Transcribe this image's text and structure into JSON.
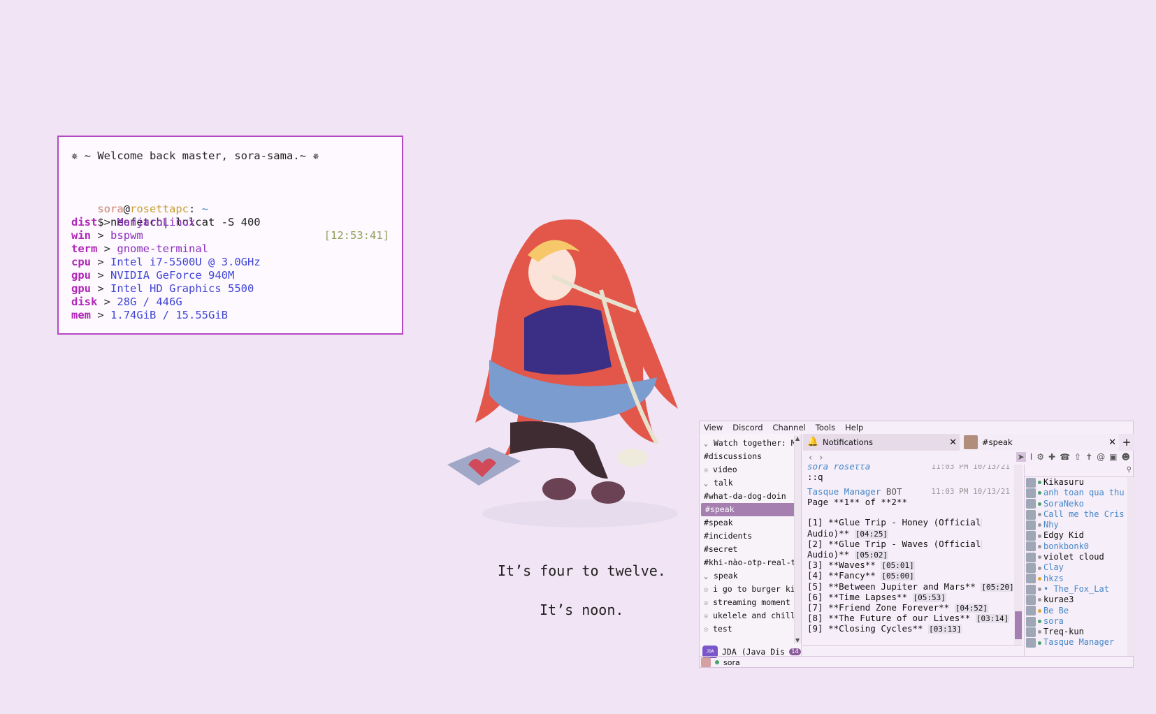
{
  "terminal": {
    "welcome": "✵ ~ Welcome back master, sora-sama.~ ✵",
    "prompt_user": "sora",
    "prompt_at": "@",
    "prompt_host": "rosettapc",
    "prompt_sep": ": ",
    "prompt_dir": "~",
    "command": "$ neofetch| lolcat -S 400",
    "time": "[12:53:41]",
    "neofetch": [
      {
        "key": "dist",
        "value": "ManjaroLinux"
      },
      {
        "key": "win",
        "value": "bspwm"
      },
      {
        "key": "term",
        "value": "gnome-terminal"
      },
      {
        "key": "cpu",
        "value": "Intel i7-5500U @ 3.0GHz"
      },
      {
        "key": "gpu",
        "value": "NVIDIA GeForce 940M"
      },
      {
        "key": "gpu",
        "value": "Intel HD Graphics 5500"
      },
      {
        "key": "disk",
        "value": "28G / 446G"
      },
      {
        "key": "mem",
        "value": "1.74GiB / 15.55GiB"
      }
    ],
    "arrow": ">"
  },
  "captions": {
    "line1": "It’s four to twelve.",
    "line2": "It’s noon."
  },
  "client": {
    "menu": [
      "View",
      "Discord",
      "Channel",
      "Tools",
      "Help"
    ],
    "channels": [
      {
        "type": "category",
        "label": "Watch together: MC"
      },
      {
        "type": "text",
        "label": "#discussions"
      },
      {
        "type": "voice",
        "label": "video"
      },
      {
        "type": "category",
        "label": "talk"
      },
      {
        "type": "text",
        "label": "#what-da-dog-doin"
      },
      {
        "type": "text",
        "label": "#speak",
        "selected": true
      },
      {
        "type": "text",
        "label": "#speak"
      },
      {
        "type": "text",
        "label": "#incidents"
      },
      {
        "type": "text",
        "label": "#secret"
      },
      {
        "type": "text",
        "label": "#khi-nào-otp-real-th"
      },
      {
        "type": "category",
        "label": "speak"
      },
      {
        "type": "voice",
        "label": "i go to burger kin"
      },
      {
        "type": "voice",
        "label": "streaming moment"
      },
      {
        "type": "voice",
        "label": "ukelele and chill"
      },
      {
        "type": "voice",
        "label": "test"
      }
    ],
    "guild": {
      "label": "JDA (Java Dis",
      "icon_text": "JDA",
      "badge": "14"
    },
    "self_user": "sora",
    "tabs": [
      {
        "label": "Notifications",
        "close": "✕"
      },
      {
        "label": "#speak",
        "close": "✕"
      }
    ],
    "new_tab": "+",
    "messages": {
      "prev_author": "sora rosetta",
      "prev_meta": "11:03 PM  10/13/21",
      "prev_text": "::q",
      "author": "Tasque Manager",
      "bot_tag": "BOT",
      "meta": "11:03 PM  10/13/21",
      "page_line": "Page **1** of **2**",
      "lines": [
        {
          "text": "[1] **Glue Trip -  Honey (Official",
          "tag": ""
        },
        {
          "text": "Audio)** ",
          "tag": "[04:25]"
        },
        {
          "text": "[2] **Glue Trip -  Waves (Official",
          "tag": ""
        },
        {
          "text": "Audio)** ",
          "tag": "[05:02]"
        },
        {
          "text": "[3] **Waves** ",
          "tag": "[05:01]"
        },
        {
          "text": "[4] **Fancy** ",
          "tag": "[05:00]"
        },
        {
          "text": "[5] **Between Jupiter and Mars** ",
          "tag": "[05:20]"
        },
        {
          "text": "[6] **Time Lapses** ",
          "tag": "[05:53]"
        },
        {
          "text": "[7] **Friend Zone Forever** ",
          "tag": "[04:52]"
        },
        {
          "text": "[8] **The Future of our Lives** ",
          "tag": "[03:14]"
        },
        {
          "text": "[9] **Closing Cycles** ",
          "tag": "[03:13]"
        }
      ]
    },
    "members": [
      {
        "name": "Kikasuru",
        "color": "#111111",
        "status": "#4aa36c"
      },
      {
        "name": "anh toan qua thu",
        "color": "#4587c9",
        "status": "#4aa36c"
      },
      {
        "name": "SoraNeko",
        "color": "#4587c9",
        "status": "#4aa36c"
      },
      {
        "name": "Call me the Cris",
        "color": "#4587c9",
        "status": "#999999"
      },
      {
        "name": "Nhy",
        "color": "#4587c9",
        "status": "#999999"
      },
      {
        "name": "Edgy Kid",
        "color": "#111111",
        "status": "#999999"
      },
      {
        "name": "bonkbonk0",
        "color": "#4587c9",
        "status": "#999999"
      },
      {
        "name": "violet cloud",
        "color": "#111111",
        "status": "#999999"
      },
      {
        "name": "Clay",
        "color": "#4587c9",
        "status": "#999999"
      },
      {
        "name": "hkzs",
        "color": "#4587c9",
        "status": "#e0a23a"
      },
      {
        "name": "• The_Fox_Lat",
        "color": "#4587c9",
        "status": "#999999"
      },
      {
        "name": "kurae3",
        "color": "#111111",
        "status": "#999999"
      },
      {
        "name": "Be Be",
        "color": "#4587c9",
        "status": "#e0a23a"
      },
      {
        "name": "sora",
        "color": "#4587c9",
        "status": "#4aa36c"
      },
      {
        "name": "Treq-kun",
        "color": "#111111",
        "status": "#999999"
      },
      {
        "name": "Tasque Manager",
        "color": "#4587c9",
        "status": "#4aa36c"
      }
    ],
    "colors": {
      "accent": "#a57fb0",
      "border": "#b548c4",
      "link": "#4587c9"
    }
  }
}
